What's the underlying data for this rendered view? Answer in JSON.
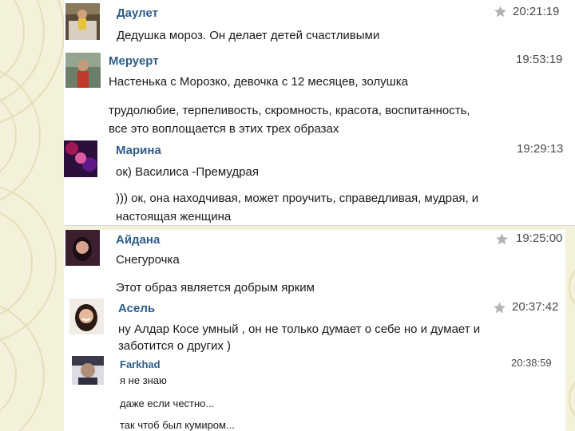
{
  "messages": [
    {
      "name": "Даулет",
      "time": "20:21:19",
      "lines": [
        "Дедушка мороз. Он делает детей счастливыми"
      ],
      "starred": true
    },
    {
      "name": "Меруерт",
      "time": "19:53:19",
      "lines": [
        "Настенька с Морозко, девочка с 12 месяцев, золушка"
      ],
      "starred": false
    },
    {
      "name": "",
      "time": "",
      "lines": [
        "трудолюбие, терпеливость, скромность, красота, воспитанность,",
        "все это воплощается в этих трех образах"
      ],
      "starred": false
    },
    {
      "name": "Марина",
      "time": "19:29:13",
      "lines": [
        "ок) Василиса -Премудрая"
      ],
      "starred": false
    },
    {
      "name": "",
      "time": "",
      "lines": [
        ")))  ок, она находчивая, может проучить, справедливая, мудрая, и",
        "настоящая женщина"
      ],
      "starred": false
    },
    {
      "name": "Айдана",
      "time": "19:25:00",
      "lines": [
        "Снегурочка"
      ],
      "starred": true
    },
    {
      "name": "",
      "time": "",
      "lines": [
        "Этот образ является добрым ярким"
      ],
      "starred": false
    },
    {
      "name": "Асель",
      "time": "20:37:42",
      "lines": [
        "ну Алдар Косе умный , он не только думает о себе но и думает и",
        "заботится о других )"
      ],
      "starred": true
    },
    {
      "name": "Farkhad",
      "time": "20:38:59",
      "lines": [
        "я не знаю"
      ],
      "starred": false
    },
    {
      "name": "",
      "time": "",
      "lines": [
        "даже если честно..."
      ],
      "starred": false
    },
    {
      "name": "",
      "time": "",
      "lines": [
        "так чтоб был кумиром..."
      ],
      "starred": false
    }
  ],
  "icons": {
    "star": "star-icon",
    "avatar": "avatar"
  },
  "colors": {
    "name": "#2d5c8a",
    "text": "#1a1a1a",
    "time": "#4a4a4a",
    "star": "#b3b3b3",
    "background": "#f3f1da"
  }
}
